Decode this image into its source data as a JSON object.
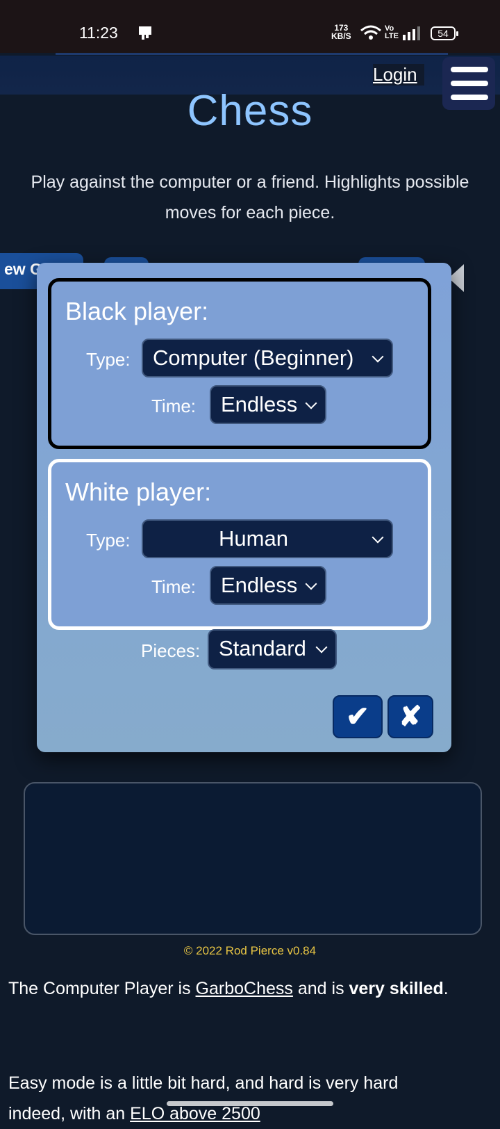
{
  "status_bar": {
    "time": "11:23",
    "speed_value": "173",
    "speed_unit": "KB/S",
    "volte_top": "Vo",
    "volte_bottom": "LTE",
    "battery": "54"
  },
  "header": {
    "login_label": "Login",
    "menu_icon": "hamburger-icon"
  },
  "page": {
    "title": "Chess",
    "subtitle_line1": "Play against the computer or a friend. Highlights possible",
    "subtitle_line2": "moves for each piece.",
    "bg_tab_label": "ew G"
  },
  "dialog": {
    "black": {
      "title": "Black player:",
      "type_label": "Type:",
      "type_value": "Computer (Beginner)",
      "time_label": "Time:",
      "time_value": "Endless"
    },
    "white": {
      "title": "White player:",
      "type_label": "Type:",
      "type_value": "Human",
      "time_label": "Time:",
      "time_value": "Endless"
    },
    "pieces_label": "Pieces:",
    "pieces_value": "Standard",
    "confirm_glyph": "✔",
    "cancel_glyph": "✘"
  },
  "footer": {
    "copyright": "© 2022 Rod Pierce v0.84",
    "computer_prefix": "The Computer Player is ",
    "computer_link": "GarboChess",
    "computer_mid": " and is ",
    "computer_bold": "very skilled",
    "computer_suffix": ".",
    "easy_line1": "Easy mode is a little bit hard, and hard is very hard",
    "easy_line2_prefix": "indeed, with an ",
    "easy_line2_link": "ELO above 2500"
  },
  "colors": {
    "title": "#8ec5ff",
    "dialog_bg": "#7fa2d8",
    "select_bg": "#0e2145",
    "copyright": "#e8c544"
  }
}
